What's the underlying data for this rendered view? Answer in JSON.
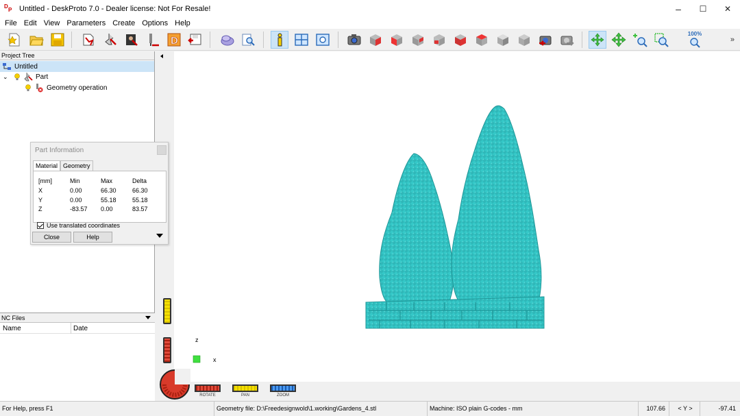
{
  "window": {
    "title": "Untitled - DeskProto 7.0 - Dealer license: Not For Resale!",
    "minimize": "–",
    "maximize": "☐",
    "close": "✕"
  },
  "menu": [
    "File",
    "Edit",
    "View",
    "Parameters",
    "Create",
    "Options",
    "Help"
  ],
  "toolbar": {
    "zoom_percent": "100%",
    "overflow": "»"
  },
  "project_tree": {
    "header": "Project Tree",
    "root": "Untitled",
    "part": "Part",
    "operation": "Geometry operation"
  },
  "nc_files": {
    "header": "NC Files",
    "col_name": "Name",
    "col_date": "Date"
  },
  "part_info": {
    "title": "Part Information",
    "tabs": [
      "Material",
      "Geometry"
    ],
    "columns": [
      "[mm]",
      "Min",
      "Max",
      "Delta"
    ],
    "rows": [
      {
        "axis": "X",
        "min": "0.00",
        "max": "66.30",
        "delta": "66.30"
      },
      {
        "axis": "Y",
        "min": "0.00",
        "max": "55.18",
        "delta": "55.18"
      },
      {
        "axis": "Z",
        "min": "-83.57",
        "max": "0.00",
        "delta": "83.57"
      }
    ],
    "use_translated": "Use translated coordinates",
    "close_label": "Close",
    "help_label": "Help"
  },
  "viewport": {
    "axis_z": "z",
    "axis_x": "x",
    "rotate_label": "ROTATE",
    "pan_label": "PAN",
    "zoom_label": "ZOOM",
    "model_color": "#35c8c8"
  },
  "status": {
    "help": "For Help, press F1",
    "geometry_file": "Geometry file: D:\\Freedesignwold\\1.working\\Gardens_4.stl",
    "machine": "Machine: ISO plain G-codes - mm",
    "coord1": "107.66",
    "axis_sel": "< Y >",
    "coord2": "-97.41"
  }
}
